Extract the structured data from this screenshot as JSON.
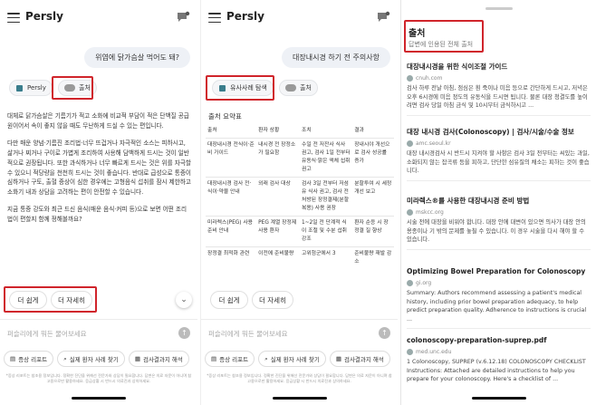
{
  "app": {
    "title": "Persly"
  },
  "panel1": {
    "question": "위염에 닭가슴살 먹어도 돼?",
    "chip_persly": "Persly",
    "chip_source": "출처",
    "answer": [
      "대체로 닭가슴살은 기름기가 적고 소화에 비교적 부담이 적은 단백질 공급원이어서 속이 좋지 않을 때도 무난하게 드실 수 있는 편입니다.",
      "다만 매운 양념·기름진 조리법·너무 뜨겁거나 자극적인 소스는 피하시고, 삶거나 찌거나 구이로 가볍게 조리하여 사용해 담백하게 드시는 것이 일반적으로 권장됩니다. 또한 과식하거나 너무 빠르게 드시는 것은 위를 자극할 수 있으니 적당량을 천천히 드시는 것이 좋습니다. 반대로 급성으로 통증이 심하거나 구토, 출혈 증상이 심한 경우에는 고형음식 섭취를 잠시 제한하고 소화기 내과 상담을 고려하는 편이 안전할 수 있습니다.",
      "지금 통증 강도와 최근 드신 음식(매운 음식·커피 등)으로 보면 어떤 조리법이 편할지 함께 정해볼까요?"
    ],
    "btn_easier": "더 쉽게",
    "btn_detail": "더 자세히"
  },
  "panel2": {
    "question": "대장내시경 하기 전 주의사항",
    "chip_similar": "유사사례 탐색",
    "chip_source": "출처",
    "section_title": "출처 요약표",
    "table_headers": [
      "출처",
      "환자 상황",
      "조치",
      "결과"
    ],
    "table_rows": [
      [
        "대장내시경 전식이·준비 가이드",
        "내시경 전 장정소가 필요함",
        "수일 전 저잔사 식사 권고, 검사 1일 전부터 유동식·맑은 액체 섭취 권고",
        "장내시야 개선으로 검사 성공률 증가"
      ],
      [
        "대장내시경 검사 전·식이·약물 안내",
        "외래 검사 대상",
        "검사 3일 전부터 저섬유 식사 권고, 검사 전 처방된 장정결제(분할 복용) 사용 권장",
        "분할투여 시 세정 개선 보고"
      ],
      [
        "미라렉스(PEG) 사용 준비 안내",
        "PEG 계열 장정제 사용 환자",
        "1~2일 전 단계적 식이 조절 및 수분 섭취 강조",
        "환자 순응 시 장정결 질 향상"
      ],
      [
        "장정결 최적화 관련",
        "이전에 준비불량",
        "고위험군에서 3",
        "준비불량 재발 감소"
      ]
    ],
    "btn_easier": "더 쉽게",
    "btn_detail": "더 자세히"
  },
  "panel3": {
    "title": "출처",
    "subtitle": "답변에 인용된 전체 출처",
    "sources": [
      {
        "title": "대장내시경을 위한 식이조절 가이드",
        "domain": "cnuh.com",
        "snippet": "검사 하루 전날 아침, 점심은 흰 죽이나 미음 등으로 간단하게 드시고, 저녁은 오후 6시경에 미음 정도의 유동식을 드시면 됩니다. 물론 대장 청결도를 높이려면 검사 당일 아침 금식 및 10시부터 금식하시고 ..."
      },
      {
        "title": "대장 내시경 검사(Colonoscopy) | 검사/시술/수술 정보",
        "domain": "amc.seoul.kr",
        "snippet": "대장 내시경검사 시 반드시 지켜야 할 사항은 검사 3일 전부터는 씨있는 과일, 소화되지 않는 잡곡류 등을 피하고, 단단한 섬유질의 채소는 피하는 것이 좋습니다."
      },
      {
        "title": "미라렉스®를 사용한 대장내시경 준비 방법",
        "domain": "mskcc.org",
        "snippet": "시술 전에 대장을 비워야 합니다. 대장 안에 대변이 있으면 의사가 대장 안의 용종이나 기 밖의 문제를 놓칠 수 있습니다. 이 경우 시술을 다시 해야 할 수 있습니다."
      },
      {
        "title": "Optimizing Bowel Preparation for Colonoscopy",
        "domain": "gi.org",
        "snippet": "Summary: Authors recommend assessing a patient's medical history, including prior bowel preparation adequacy, to help predict preparation quality. Adherence to instructions is crucial ..."
      },
      {
        "title": "colonoscopy-preparation-suprep.pdf",
        "domain": "med.unc.edu",
        "snippet": "1 Colonoscopy, SUPREP (v.6.12.18) COLONOSCOPY CHECKLIST Instructions: Attached are detailed instructions to help you prepare for your colonoscopy. Here's a checklist of ..."
      }
    ]
  },
  "common": {
    "input_placeholder": "퍼슬리에게 뭐든 물어보세요",
    "chips": [
      "증상 리포트",
      "실제 환자 사례 찾기",
      "검사결과지 해석"
    ],
    "disclaimer": "*증상 리포트는 참조용 정보입니다. 정확한 진단을 위해선 전문가와 상담이 필요합니다. 답변은 의료 자문이 아니며 참고용으로만 활용하세요. 응급상황 시 반드시 의료진과 상의하세요."
  },
  "colors": {
    "highlight": "#d0242b",
    "chip_bg": "#f5f6f8",
    "question_bg": "#eef1f6"
  }
}
